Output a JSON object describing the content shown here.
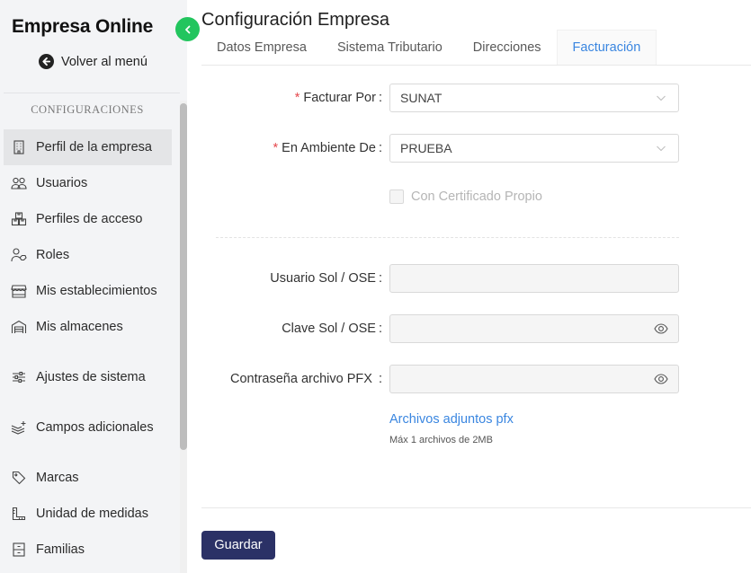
{
  "sidebar": {
    "brand": "Empresa Online",
    "back_label": "Volver al menú",
    "section_title": "CONFIGURACIONES",
    "items": [
      {
        "label": "Perfil de la empresa",
        "icon": "building-icon",
        "active": true
      },
      {
        "label": "Usuarios",
        "icon": "users-icon"
      },
      {
        "label": "Perfiles de acceso",
        "icon": "boxes-icon"
      },
      {
        "label": "Roles",
        "icon": "user-tag-icon"
      },
      {
        "label": "Mis establecimientos",
        "icon": "store-icon"
      },
      {
        "label": "Mis almacenes",
        "icon": "warehouse-icon"
      },
      {
        "label": "Ajustes de sistema",
        "icon": "sliders-icon"
      },
      {
        "label": "Campos adicionales",
        "icon": "layers-plus-icon"
      },
      {
        "label": "Marcas",
        "icon": "tag-icon"
      },
      {
        "label": "Unidad de medidas",
        "icon": "ruler-icon"
      },
      {
        "label": "Familias",
        "icon": "archive-icon"
      }
    ]
  },
  "header": {
    "title": "Configuración Empresa"
  },
  "tabs": [
    {
      "label": "Datos Empresa"
    },
    {
      "label": "Sistema Tributario"
    },
    {
      "label": "Direcciones"
    },
    {
      "label": "Facturación",
      "active": true
    }
  ],
  "form": {
    "facturar_por": {
      "label": "Facturar Por",
      "value": "SUNAT",
      "required": true
    },
    "ambiente": {
      "label": "En Ambiente De",
      "value": "PRUEBA",
      "required": true
    },
    "certificado": {
      "label": "Con Certificado Propio",
      "checked": false,
      "disabled": true
    },
    "usuario_sol": {
      "label": "Usuario Sol / OSE",
      "value": ""
    },
    "clave_sol": {
      "label": "Clave Sol / OSE",
      "value": ""
    },
    "pfx_password": {
      "label": "Contraseña archivo PFX ",
      "value": ""
    },
    "attachments_link": "Archivos adjuntos pfx",
    "attachments_hint": "Máx 1 archivos de 2MB"
  },
  "actions": {
    "save_label": "Guardar"
  },
  "colors": {
    "accent": "#3a86e0",
    "primary_button": "#2b3166",
    "collapse_button": "#22c55e",
    "required": "#e5484d"
  }
}
